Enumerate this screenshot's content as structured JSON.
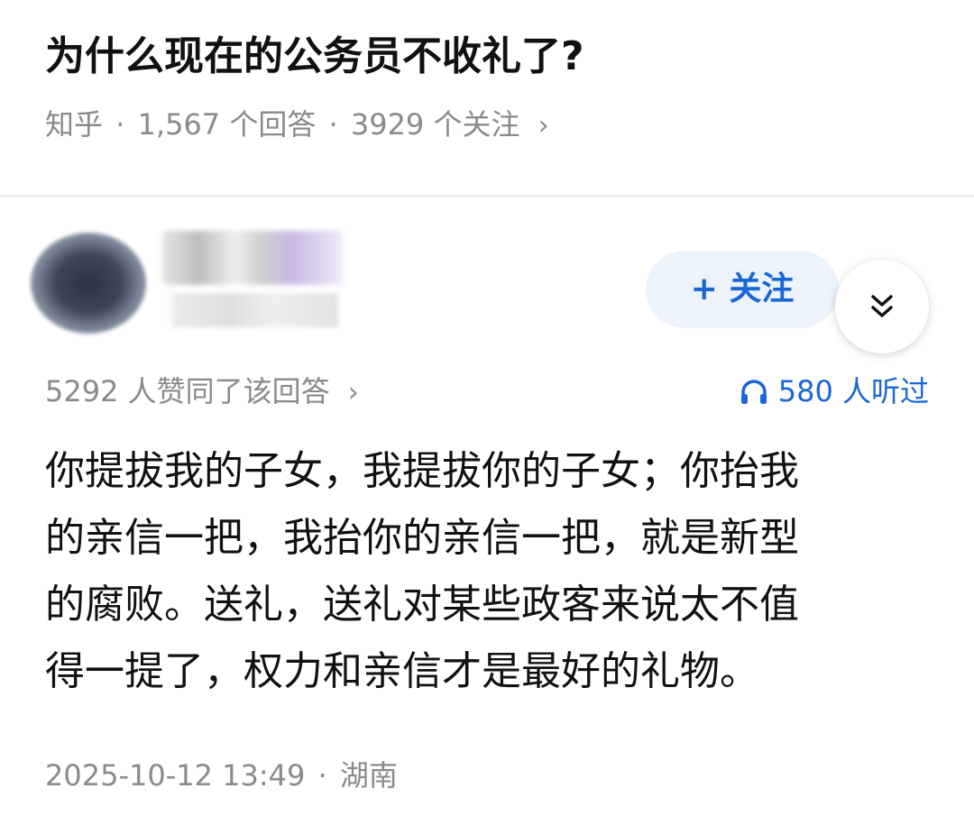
{
  "question": {
    "title": "为什么现在的公务员不收礼了?",
    "source": "知乎",
    "answers_count": "1,567 个回答",
    "followers_count": "3929 个关注",
    "separator": "·",
    "chevron": "›"
  },
  "answer": {
    "follow_label": "+ 关注",
    "expand_icon": "double-chevron-down-icon",
    "upvotes": "5292 人赞同了该回答",
    "listens": "580 人听过",
    "listen_icon": "headphones-icon",
    "body_lines": [
      "你提拔我的子女，我提拔你的子女；你抬我",
      "的亲信一把，我抬你的亲信一把，就是新型",
      "的腐败。送礼，送礼对某些政客来说太不值",
      "得一提了，权力和亲信才是最好的礼物。"
    ],
    "date": "2025-10-12 13:49",
    "location": "湖南"
  },
  "colors": {
    "accent_blue": "#1a66d6",
    "follow_bg": "#edf3fb",
    "meta_gray": "#8a8a8a",
    "text": "#111111"
  }
}
